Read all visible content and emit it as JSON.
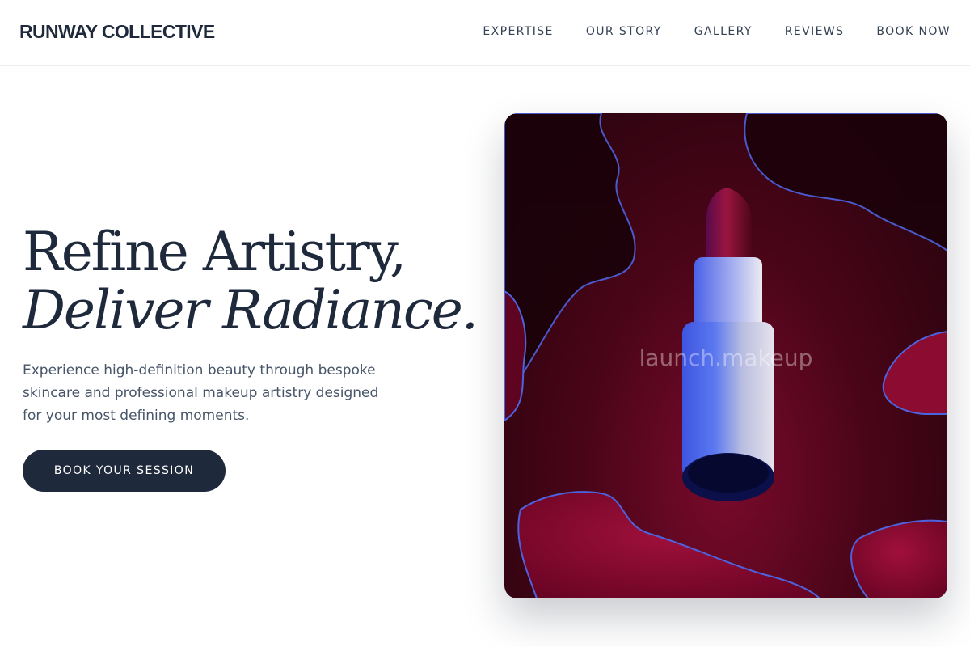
{
  "header": {
    "brand": "RUNWAY COLLECTIVE",
    "nav": [
      {
        "label": "EXPERTISE"
      },
      {
        "label": "OUR STORY"
      },
      {
        "label": "GALLERY"
      },
      {
        "label": "REVIEWS"
      },
      {
        "label": "BOOK NOW"
      }
    ]
  },
  "hero": {
    "headline_line1": "Refine Artistry,",
    "headline_line2": "Deliver Radiance.",
    "subtext": "Experience high-definition beauty through bespoke skincare and professional makeup artistry designed for your most defining moments.",
    "cta_label": "BOOK YOUR SESSION",
    "image_watermark": "launch.makeup"
  },
  "colors": {
    "primary": "#1e293b",
    "text_muted": "#475569",
    "lipstick_bullet": "#8b0a2e",
    "lipstick_tube": "#4a62e8",
    "background_image": "#4a0518"
  }
}
